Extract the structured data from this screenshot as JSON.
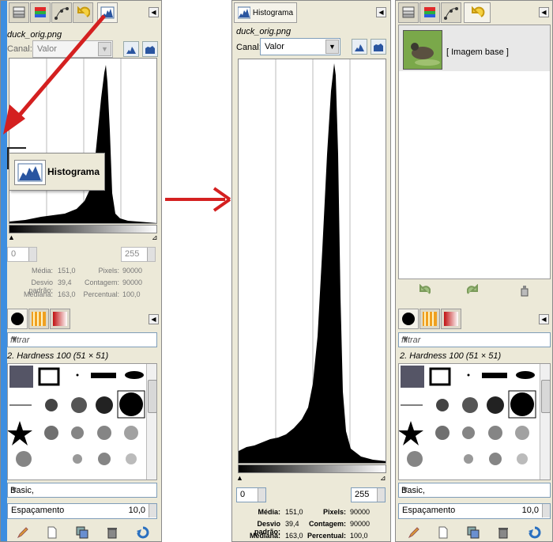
{
  "left_panel": {
    "filename": "duck_orig.png",
    "channel_label": "Canal:",
    "channel_value": "Valor",
    "range_min": "0",
    "range_max": "255",
    "tooltip": "Histograma",
    "stats": {
      "media_label": "Média:",
      "media_value": "151,0",
      "desvio_label": "Desvio padrão:",
      "desvio_value": "39,4",
      "mediana_label": "Mediana:",
      "mediana_value": "163,0",
      "pixels_label": "Pixels:",
      "pixels_value": "90000",
      "contagem_label": "Contagem:",
      "contagem_value": "90000",
      "percentual_label": "Percentual:",
      "percentual_value": "100,0"
    },
    "filter_placeholder": "filtrar",
    "brush_title": "2. Hardness 100 (51 × 51)",
    "preset": "Basic,",
    "spacing_label": "Espaçamento",
    "spacing_value": "10,0"
  },
  "center_panel": {
    "tab_label": "Histograma",
    "filename": "duck_orig.png",
    "channel_label": "Canal:",
    "channel_value": "Valor",
    "range_min": "0",
    "range_max": "255",
    "stats": {
      "media_label": "Média:",
      "media_value": "151,0",
      "desvio_label": "Desvio padrão:",
      "desvio_value": "39,4",
      "mediana_label": "Mediana:",
      "mediana_value": "163,0",
      "pixels_label": "Pixels:",
      "pixels_value": "90000",
      "contagem_label": "Contagem:",
      "contagem_value": "90000",
      "percentual_label": "Percentual:",
      "percentual_value": "100,0"
    }
  },
  "right_panel": {
    "layer_name": "[ Imagem base ]",
    "filter_placeholder": "filtrar",
    "brush_title": "2. Hardness 100 (51 × 51)",
    "preset": "Basic,",
    "spacing_label": "Espaçamento",
    "spacing_value": "10,0"
  },
  "colors": {
    "dock_bg": "#ece9d8",
    "arrow_red": "#d42020",
    "panel_blue": "#3d8ee0"
  }
}
